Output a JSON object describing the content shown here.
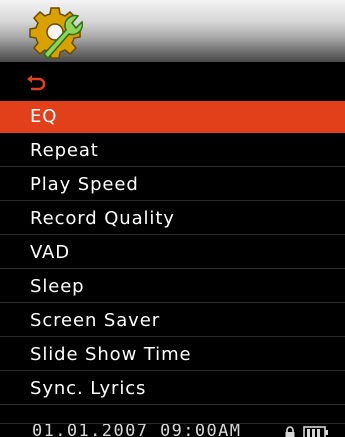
{
  "header": {
    "icon": "settings-gear-wrench-icon"
  },
  "back": {
    "icon": "back-arrow-icon",
    "color": "#e2401b"
  },
  "menu": {
    "selected_index": 0,
    "selected_color": "#e2401b",
    "items": [
      {
        "label": "EQ"
      },
      {
        "label": "Repeat"
      },
      {
        "label": "Play Speed"
      },
      {
        "label": "Record Quality"
      },
      {
        "label": "VAD"
      },
      {
        "label": "Sleep"
      },
      {
        "label": "Screen Saver"
      },
      {
        "label": "Slide Show Time"
      },
      {
        "label": "Sync. Lyrics"
      }
    ]
  },
  "status": {
    "datetime": "01.01.2007  09:00AM",
    "icons": [
      "lock-icon",
      "battery-icon"
    ]
  }
}
